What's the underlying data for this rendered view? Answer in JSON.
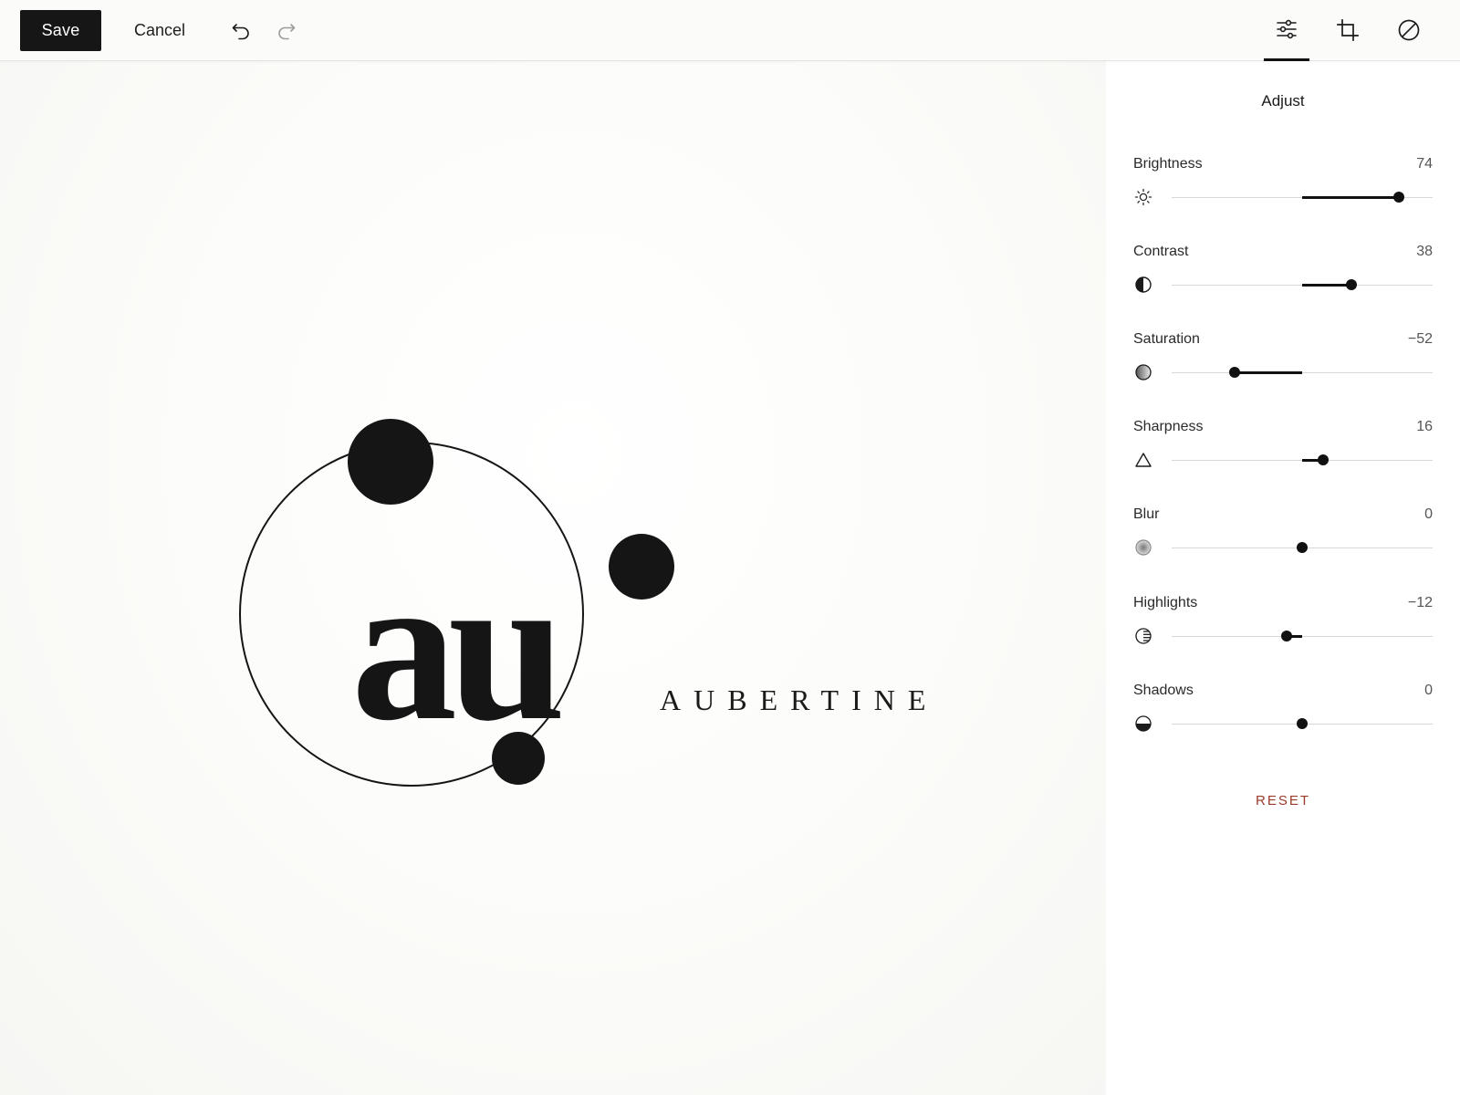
{
  "toolbar": {
    "save_label": "Save",
    "cancel_label": "Cancel",
    "undo_icon": "undo-icon",
    "redo_icon": "redo-icon",
    "tabs": [
      {
        "icon": "sliders-icon",
        "active": true
      },
      {
        "icon": "crop-icon",
        "active": false
      },
      {
        "icon": "no-filter-icon",
        "active": false
      }
    ]
  },
  "canvas": {
    "logo": {
      "monogram": "au",
      "wordmark": "AUBERTINE"
    }
  },
  "panel": {
    "title": "Adjust",
    "adjustments": [
      {
        "key": "brightness",
        "label": "Brightness",
        "value": 74,
        "display": "74",
        "icon": "sun-icon"
      },
      {
        "key": "contrast",
        "label": "Contrast",
        "value": 38,
        "display": "38",
        "icon": "contrast-icon"
      },
      {
        "key": "saturation",
        "label": "Saturation",
        "value": -52,
        "display": "−52",
        "icon": "saturation-icon"
      },
      {
        "key": "sharpness",
        "label": "Sharpness",
        "value": 16,
        "display": "16",
        "icon": "triangle-icon"
      },
      {
        "key": "blur",
        "label": "Blur",
        "value": 0,
        "display": "0",
        "icon": "blur-icon"
      },
      {
        "key": "highlights",
        "label": "Highlights",
        "value": -12,
        "display": "−12",
        "icon": "highlights-icon"
      },
      {
        "key": "shadows",
        "label": "Shadows",
        "value": 0,
        "display": "0",
        "icon": "shadows-icon"
      }
    ],
    "reset_label": "RESET"
  }
}
